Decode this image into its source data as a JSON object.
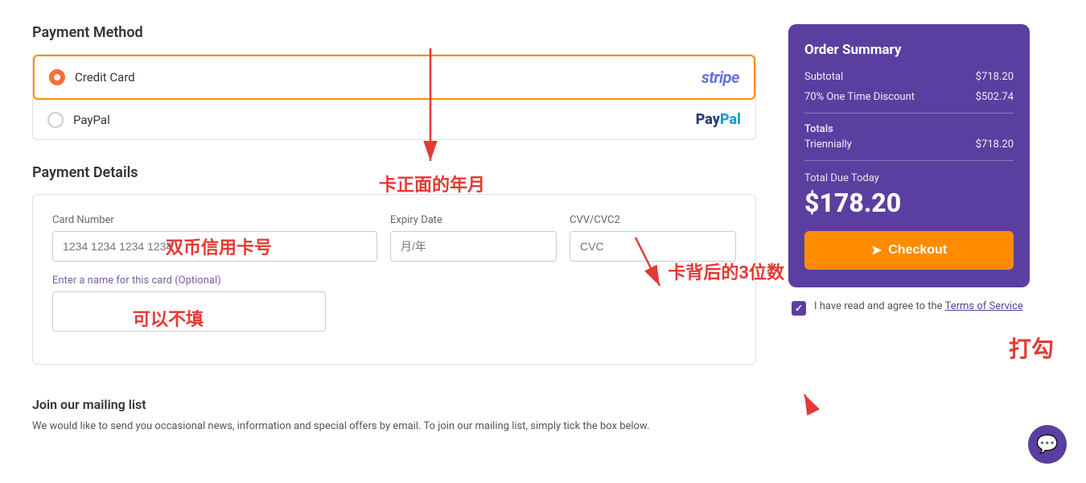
{
  "page": {
    "title": "Payment",
    "payment_method_label": "Payment Method",
    "payment_details_label": "Payment Details"
  },
  "payment_methods": [
    {
      "id": "credit_card",
      "label": "Credit Card",
      "logo": "stripe",
      "selected": true
    },
    {
      "id": "paypal",
      "label": "PayPal",
      "logo": "paypal",
      "selected": false
    }
  ],
  "card_form": {
    "card_number_label": "Card Number",
    "card_number_placeholder": "1234 1234 1234 1234",
    "expiry_label": "Expiry Date",
    "expiry_placeholder": "月/年",
    "cvv_label": "CVV/CVC2",
    "cvv_placeholder": "CVC",
    "name_label": "Enter a name for this card (Optional)"
  },
  "annotations": {
    "card_number": "双币信用卡号",
    "expiry": "卡正面的年月",
    "optional": "可以不填",
    "cvv": "卡背后的3位数",
    "checkbox": "打勾"
  },
  "order_summary": {
    "title": "Order Summary",
    "subtotal_label": "Subtotal",
    "subtotal_value": "$718.20",
    "discount_label": "70% One Time Discount",
    "discount_value": "$502.74",
    "totals_label": "Totals",
    "triennially_label": "Triennially",
    "triennially_value": "$718.20",
    "total_due_label": "Total Due Today",
    "total_due_amount": "$178.20",
    "checkout_label": "Checkout"
  },
  "terms": {
    "text": "I have read and agree to the ",
    "link_text": "Terms of Service"
  },
  "mailing": {
    "title": "Join our mailing list",
    "text": "We would like to send you occasional news, information and special offers by email. To join our mailing list, simply tick the box below."
  }
}
